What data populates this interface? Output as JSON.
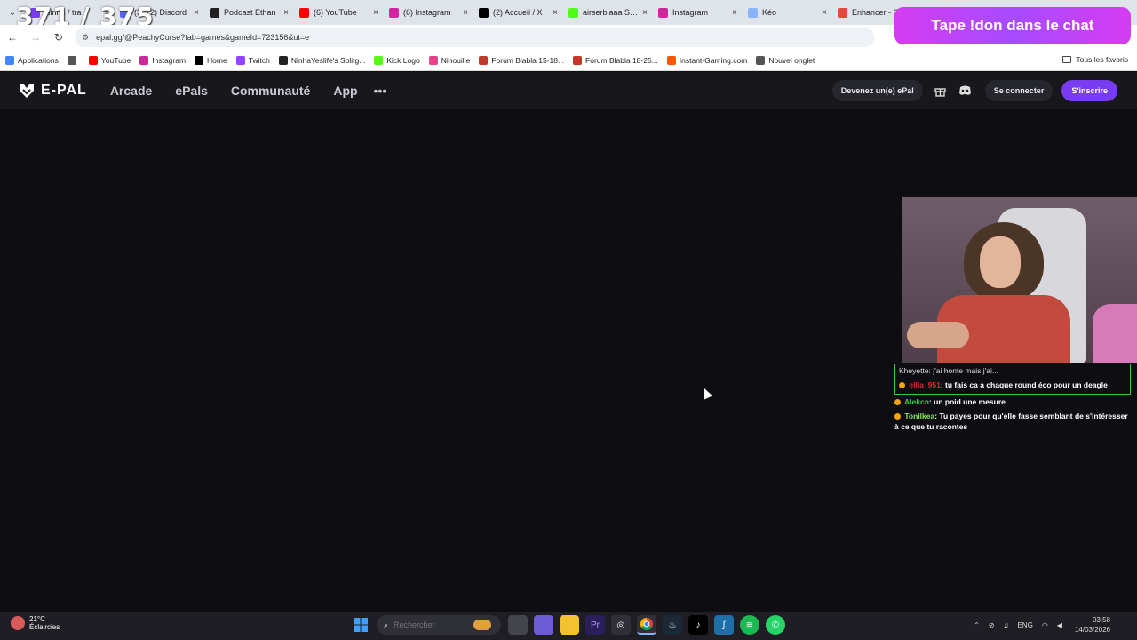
{
  "overlay": {
    "counter": "371 / 375",
    "donate_text": "Tape !don dans le chat"
  },
  "browser": {
    "tabs": [
      {
        "label": "Ninha / tra",
        "color": "#7a3cf0"
      },
      {
        "label": "(3012) Discord",
        "color": "#5865f2"
      },
      {
        "label": "Podcast Ethan",
        "color": "#222222"
      },
      {
        "label": "(6) YouTube",
        "color": "#ff0000"
      },
      {
        "label": "(6) Instagram",
        "color": "#d6249f"
      },
      {
        "label": "(2) Accueil / X",
        "color": "#000000"
      },
      {
        "label": "airserbiaaa Stre",
        "color": "#53fc18"
      },
      {
        "label": "Instagram",
        "color": "#d6249f"
      },
      {
        "label": "Kéo",
        "color": "#8ab4f8"
      },
      {
        "label": "Enhancer - Ch",
        "color": "#e8453c"
      }
    ],
    "url": "epal.gg/@PeachyCurse?tab=games&gameId=723156&ut=e",
    "bookmarks": [
      {
        "label": "Applications",
        "color": "#4285f4"
      },
      {
        "label": "",
        "color": "#555555"
      },
      {
        "label": "YouTube",
        "color": "#ff0000"
      },
      {
        "label": "Instagram",
        "color": "#d6249f"
      },
      {
        "label": "Home",
        "color": "#000000"
      },
      {
        "label": "Twitch",
        "color": "#9146ff"
      },
      {
        "label": "NinhaYeslife's Splitg...",
        "color": "#222222"
      },
      {
        "label": "Kick Logo",
        "color": "#53fc18"
      },
      {
        "label": "Ninouille",
        "color": "#e0468c"
      },
      {
        "label": "Forum Blabla 15-18...",
        "color": "#c0392b"
      },
      {
        "label": "Forum Blabla 18-25...",
        "color": "#c0392b"
      },
      {
        "label": "Instant-Gaming.com",
        "color": "#ff5400"
      },
      {
        "label": "Nouvel onglet",
        "color": "#555555"
      }
    ],
    "all_favorites": "Tous les favoris"
  },
  "site": {
    "logo": "E-PAL",
    "nav": [
      "Arcade",
      "ePals",
      "Communauté",
      "App"
    ],
    "more": "•••",
    "become": "Devenez un(e) ePal",
    "login": "Se connecter",
    "signup": "S'inscrire",
    "accent": "#7a3cf0"
  },
  "chat": {
    "reply_ref": "Kheyette: j'ai honte mais j'ai...",
    "messages": [
      {
        "user": "ellia_951",
        "text": "tu fais ca a chaque round éco pour un deagle",
        "color": "#d92b2b"
      },
      {
        "user": "Alekcn",
        "text": "un poid une mesure",
        "color": "#29d04a"
      },
      {
        "user": "Tonilkea",
        "text": "Tu payes pour qu'elle fasse semblant de s'intéresser à ce que tu racontes",
        "color": "#8ae65a"
      }
    ]
  },
  "taskbar": {
    "temp": "21°C",
    "weather": "Éclaircies",
    "search_placeholder": "Rechercher",
    "lang": "ENG",
    "time": "03:58",
    "date": "14/03/2026"
  }
}
